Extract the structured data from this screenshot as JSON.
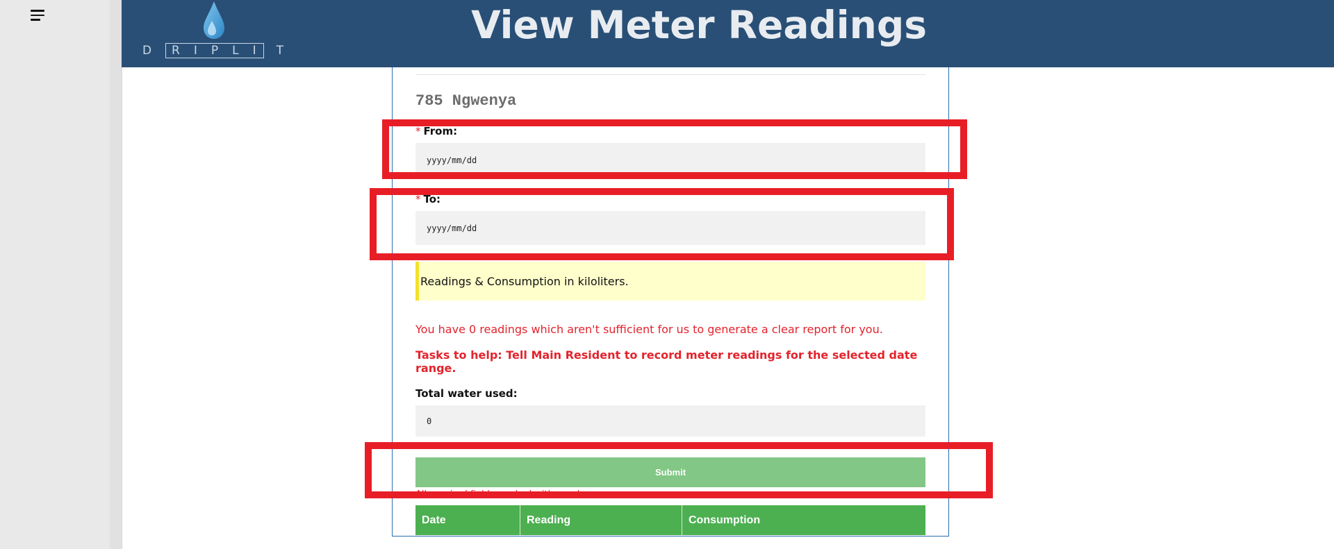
{
  "sidebar": {
    "menu_icon": "hamburger-menu-icon"
  },
  "header": {
    "logo": {
      "icon": "water-drop-icon",
      "letters": [
        "D",
        "R",
        "I",
        "P",
        "L",
        "I",
        "T"
      ]
    },
    "title": "View Meter Readings"
  },
  "form": {
    "property_name": "785 Ngwenya",
    "from": {
      "required_mark": "*",
      "label": "From:",
      "placeholder": "yyyy/mm/dd"
    },
    "to": {
      "required_mark": "*",
      "label": "To:",
      "placeholder": "yyyy/mm/dd"
    },
    "notice": "Readings & Consumption in kiloliters.",
    "warning": "You have 0 readings which aren't sufficient for us to generate a clear report for you.",
    "tasks": "Tasks to help: Tell Main Resident to record meter readings for the selected date range.",
    "total_label": "Total water used:",
    "total_value": "0",
    "submit_label": "Submit",
    "required_note": "All required fields marked with a red"
  },
  "table": {
    "columns": [
      "Date",
      "Reading",
      "Consumption"
    ]
  },
  "colors": {
    "header_bg": "#294f76",
    "table_header_bg": "#4caf50",
    "submit_bg": "#82c785",
    "notice_bg": "#ffffcc",
    "error_text": "#e3232c",
    "highlight_border": "#e81e26"
  }
}
